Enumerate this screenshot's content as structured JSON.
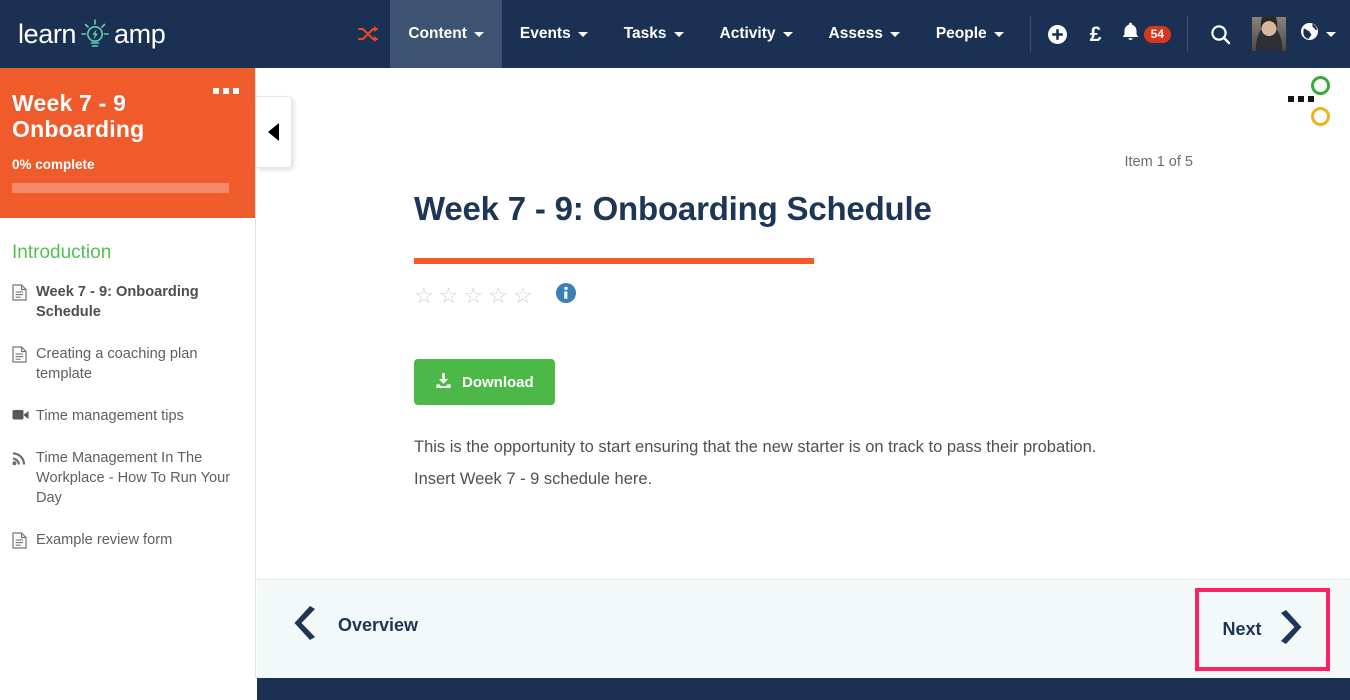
{
  "brand": {
    "logo_left": "learn",
    "logo_right": "amp",
    "logo_icon": "lightbulb-icon",
    "navy": "#1b3154",
    "orange": "#ef5b2b",
    "green": "#4cb847",
    "highlight_pink": "#ff1f63"
  },
  "topnav": {
    "shuffle_icon": "shuffle-icon",
    "items": [
      {
        "label": "Content",
        "has_caret": true,
        "active": true
      },
      {
        "label": "Events",
        "has_caret": true,
        "active": false
      },
      {
        "label": "Tasks",
        "has_caret": true,
        "active": false
      },
      {
        "label": "Activity",
        "has_caret": true,
        "active": false
      },
      {
        "label": "Assess",
        "has_caret": true,
        "active": false
      },
      {
        "label": "People",
        "has_caret": true,
        "active": false
      }
    ],
    "actions": {
      "add_icon": "plus-circle-icon",
      "currency_icon": "pound-sterling-icon",
      "notifications_icon": "bell-icon",
      "notifications_count": "54",
      "search_icon": "search-icon",
      "avatar": "user-avatar",
      "language_icon": "globe-icon"
    }
  },
  "sidebar": {
    "course_title": "Week 7 - 9 Onboarding",
    "progress_label": "0% complete",
    "progress_percent": 0,
    "menu_icon": "ellipsis-icon",
    "collapse_icon": "chevron-left-icon",
    "section_label": "Introduction",
    "items": [
      {
        "label": "Week 7 - 9: Onboarding Schedule",
        "icon": "document-icon",
        "active": true
      },
      {
        "label": "Creating a coaching plan template",
        "icon": "document-icon",
        "active": false
      },
      {
        "label": "Time management tips",
        "icon": "video-icon",
        "active": false
      },
      {
        "label": "Time Management In The Workplace - How To Run Your Day",
        "icon": "rss-icon",
        "active": false
      },
      {
        "label": "Example review form",
        "icon": "document-icon",
        "active": false
      }
    ]
  },
  "main": {
    "item_counter": "Item 1 of 5",
    "title": "Week 7 - 9: Onboarding Schedule",
    "menu_icon": "ellipsis-icon",
    "status_ring_complete": "green-circle-icon",
    "status_ring_progress": "yellow-circle-icon",
    "rating": {
      "stars_total": 5,
      "stars_filled": 0,
      "info_icon": "info-circle-icon"
    },
    "download_button": {
      "label": "Download",
      "icon": "download-icon"
    },
    "paragraphs": [
      "This is the opportunity to start ensuring that the new starter is on track to pass their probation.",
      "Insert Week 7 - 9 schedule here."
    ]
  },
  "footer": {
    "previous": {
      "label": "Overview",
      "icon": "chevron-left-icon"
    },
    "next": {
      "label": "Next",
      "icon": "chevron-right-icon",
      "highlighted": true
    }
  }
}
